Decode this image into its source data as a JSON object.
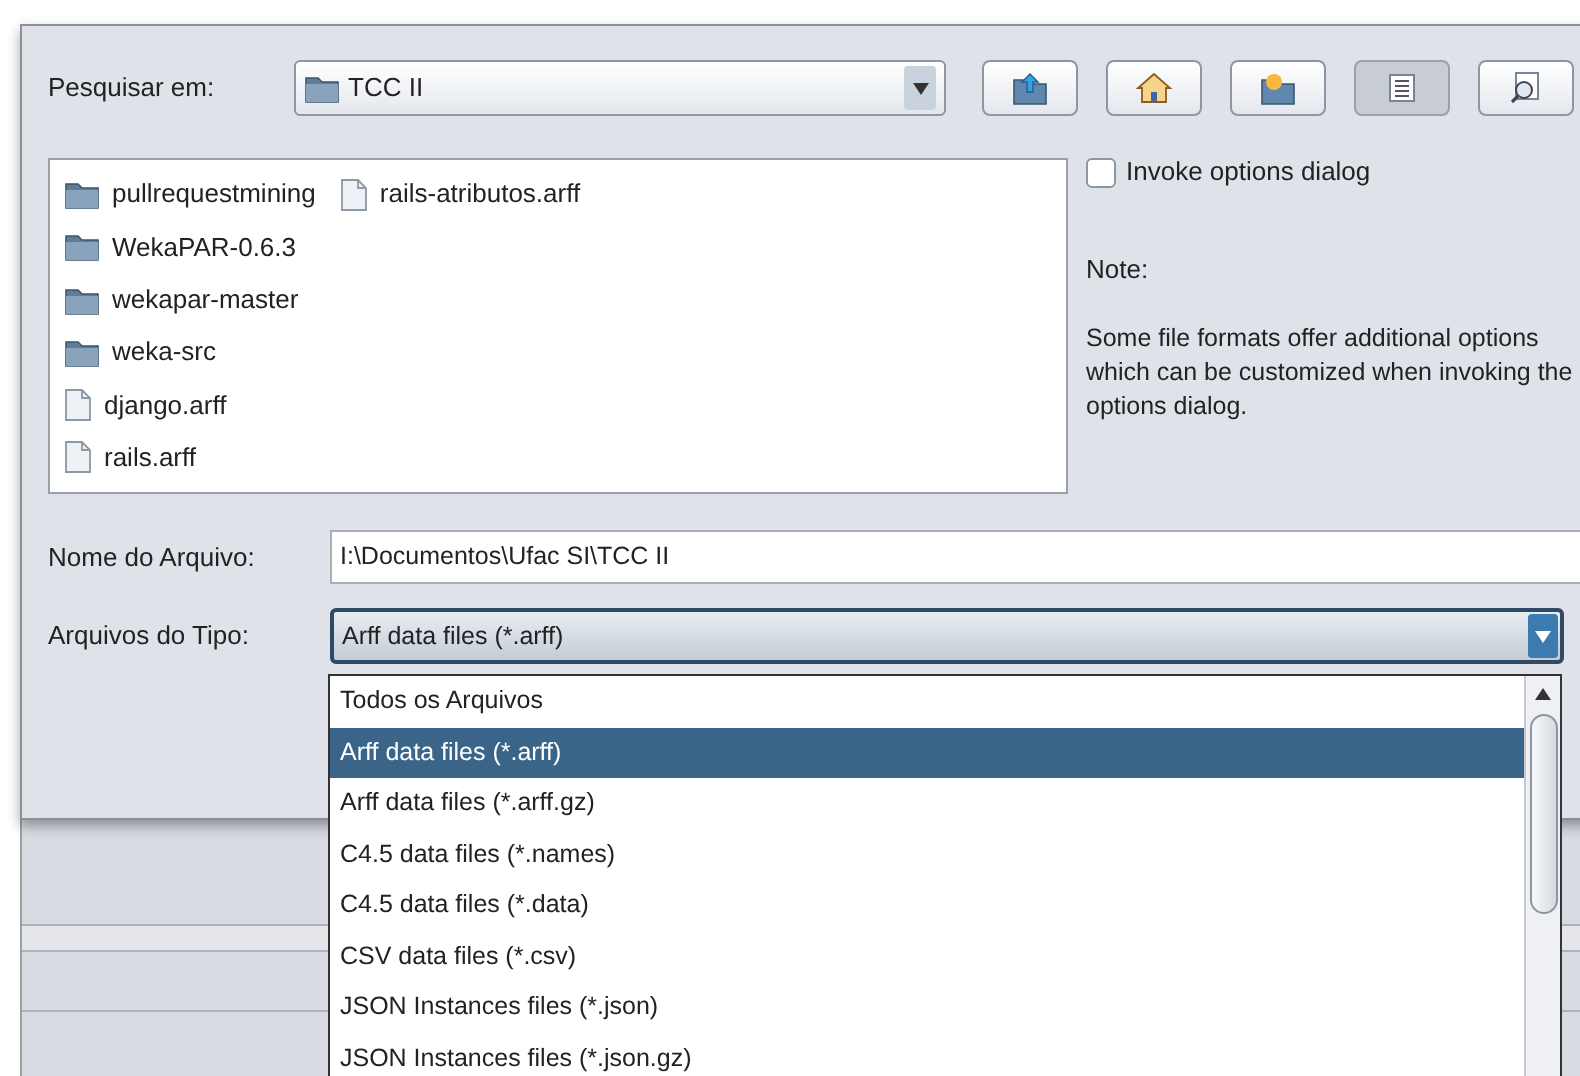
{
  "look_in": {
    "label": "Pesquisar em:",
    "value": "TCC II"
  },
  "toolbar": [
    {
      "kind": "up",
      "selected": false
    },
    {
      "kind": "home",
      "selected": false
    },
    {
      "kind": "new_folder",
      "selected": false
    },
    {
      "kind": "list",
      "selected": true
    },
    {
      "kind": "details",
      "selected": false
    }
  ],
  "files": [
    {
      "name": "pullrequestmining",
      "kind": "folder"
    },
    {
      "name": "WekaPAR-0.6.3",
      "kind": "folder"
    },
    {
      "name": "wekapar-master",
      "kind": "folder"
    },
    {
      "name": "weka-src",
      "kind": "folder"
    },
    {
      "name": "django.arff",
      "kind": "file"
    },
    {
      "name": "rails.arff",
      "kind": "file"
    },
    {
      "name": "rails-atributos.arff",
      "kind": "file"
    }
  ],
  "options": {
    "checkbox": {
      "label": "Invoke options dialog",
      "checked": false
    },
    "note_title": "Note:",
    "note": "Some file formats offer additional options which can be customized when invoking the options dialog."
  },
  "file_name": {
    "label": "Nome do Arquivo:",
    "value": "I:\\Documentos\\Ufac SI\\TCC II"
  },
  "file_type": {
    "label": "Arquivos do Tipo:",
    "value": "Arff data files (*.arff)",
    "expanded": true,
    "options": [
      {
        "label": "Todos os Arquivos",
        "selected": false
      },
      {
        "label": "Arff data files (*.arff)",
        "selected": true
      },
      {
        "label": "Arff data files (*.arff.gz)",
        "selected": false
      },
      {
        "label": "C4.5 data files (*.names)",
        "selected": false
      },
      {
        "label": "C4.5 data files (*.data)",
        "selected": false
      },
      {
        "label": "CSV data files (*.csv)",
        "selected": false
      },
      {
        "label": "JSON Instances files (*.json)",
        "selected": false
      },
      {
        "label": "JSON Instances files (*.json.gz)",
        "selected": false
      }
    ]
  }
}
